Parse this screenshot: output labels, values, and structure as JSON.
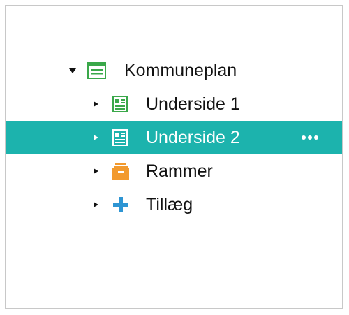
{
  "colors": {
    "selected_background": "#1cb3ad",
    "page_icon_green": "#3aa84a",
    "folder_icon_orange": "#f29a2e",
    "plus_icon_blue": "#2e95d3"
  },
  "tree": {
    "root": {
      "label": "Kommuneplan",
      "icon": "layout-icon",
      "expanded": true
    },
    "children": [
      {
        "label": "Underside 1",
        "icon": "page-icon",
        "selected": false
      },
      {
        "label": "Underside 2",
        "icon": "page-icon",
        "selected": true,
        "actions_icon": "more-icon"
      },
      {
        "label": "Rammer",
        "icon": "archive-icon",
        "selected": false
      },
      {
        "label": "Tillæg",
        "icon": "plus-icon",
        "selected": false
      }
    ]
  }
}
